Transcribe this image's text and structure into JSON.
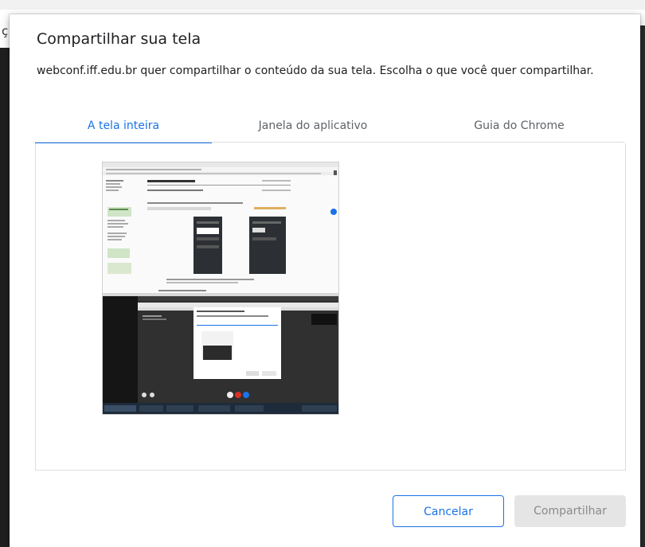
{
  "background": {
    "left_glyph": "ç"
  },
  "dialog": {
    "title": "Compartilhar sua tela",
    "description": "webconf.iff.edu.br quer compartilhar o conteúdo da sua tela. Escolha o que você quer compartilhar.",
    "tabs": [
      {
        "label": "A tela inteira",
        "active": true
      },
      {
        "label": "Janela do aplicativo",
        "active": false
      },
      {
        "label": "Guia do Chrome",
        "active": false
      }
    ],
    "buttons": {
      "cancel": "Cancelar",
      "share": "Compartilhar"
    }
  },
  "colors": {
    "accent": "#1a73e8",
    "disabled_button_bg": "#e5e5e5",
    "disabled_button_text": "#8a8a8a"
  }
}
